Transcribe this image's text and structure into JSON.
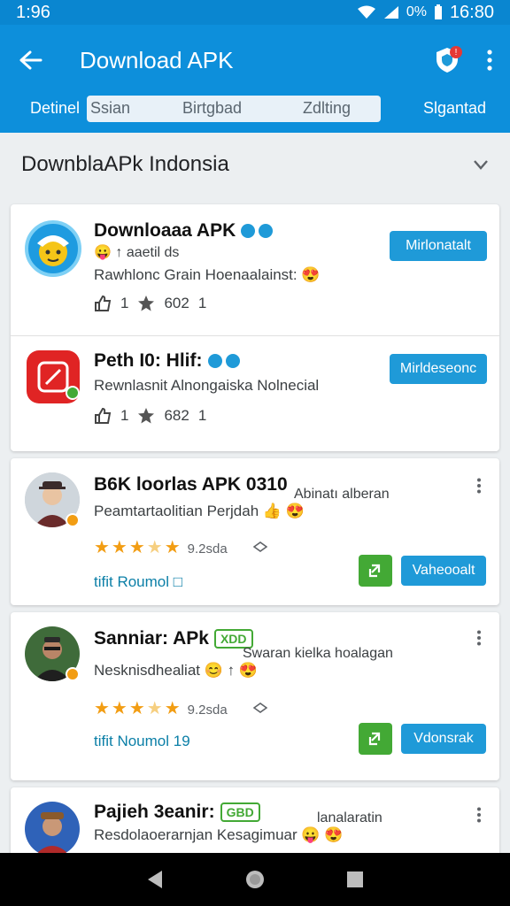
{
  "status_bar": {
    "time": "1:96",
    "battery": "0%",
    "clock": "16:80"
  },
  "app_bar": {
    "title": "Download APK",
    "notification_count": "!"
  },
  "tabs": [
    {
      "label": "Detinel"
    },
    {
      "label": "Ssian"
    },
    {
      "label": "Birtgbad"
    },
    {
      "label": "Zdlting"
    },
    {
      "label": "Slgantad"
    }
  ],
  "section": {
    "title": "DownblaAPk Indonsia"
  },
  "apps": [
    {
      "name": "Downloaaa APK",
      "meta": "😛 ↑ aaetil ds",
      "description": "Rawhlonc Grain Hoenaalainst: 😍",
      "stats": {
        "likes": "1",
        "rating": "602",
        "count": "1"
      },
      "button": "Mirlonatalt",
      "icon": "mascot-icon"
    },
    {
      "name": "Peth I0: Hlif:",
      "description": "Rewnlasnit Alnongaiska Nolnecial",
      "stats": {
        "likes": "1",
        "rating": "682",
        "count": "1"
      },
      "button": "Mirldeseonc",
      "icon": "edit-icon"
    }
  ],
  "posts": [
    {
      "name": "B6K loorlas APK 0310",
      "subtitle": "Peamtartaolitian Perjdah 👍 😍",
      "side_note": "Abinatı alberan",
      "rating": "9.2sda",
      "link": "tifit Roumol □",
      "button": "Vaheooalt",
      "avatar": "person-avatar-1"
    },
    {
      "name": "Sanniar: APk",
      "tag": "XDD",
      "subtitle": "Nesknisdhealiat 😊 ↑ 😍",
      "side_note": "Swaran kielka hoalagan",
      "rating": "9.2sda",
      "link": "tifit Noumol 19",
      "button": "Vdonsrak",
      "avatar": "person-avatar-2"
    },
    {
      "name": "Pajieh 3eanir:",
      "tag": "GBD",
      "subtitle": "Resdolaoerarnjan Kesagimuar 😛 😍",
      "side_note": "lanalaratin",
      "avatar": "person-avatar-3"
    }
  ],
  "colors": {
    "primary": "#0d8fdb",
    "accent": "#1f9ad8",
    "green": "#43a935",
    "star": "#f29d13"
  }
}
